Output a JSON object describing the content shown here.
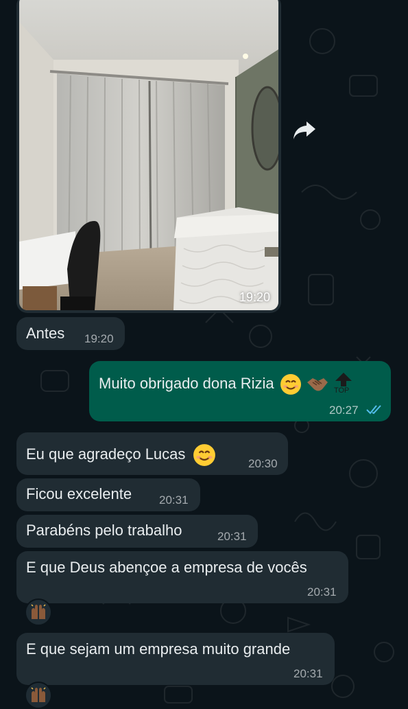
{
  "photo_message": {
    "time": "19:20"
  },
  "messages": [
    {
      "text": "Antes",
      "time": "19:20",
      "direction": "in"
    },
    {
      "text": "Muito obrigado dona Rizia",
      "time": "20:27",
      "direction": "out",
      "status": "read",
      "emojis": [
        "smiling-face-icon",
        "handshake-icon",
        "top-arrow-icon"
      ]
    },
    {
      "text": "Eu que agradeço Lucas",
      "time": "20:30",
      "direction": "in",
      "emojis": [
        "smiling-face-icon"
      ]
    },
    {
      "text": "Ficou excelente",
      "time": "20:31",
      "direction": "in"
    },
    {
      "text": "Parabéns pelo trabalho",
      "time": "20:31",
      "direction": "in"
    },
    {
      "text": "E que Deus abençoe a empresa de vocês",
      "time": "20:31",
      "direction": "in",
      "reaction": "raised-hands-icon"
    },
    {
      "text": "E que sejam um empresa muito grande",
      "time": "20:31",
      "direction": "in",
      "reaction": "raised-hands-icon"
    }
  ],
  "top_label": "TOP",
  "colors": {
    "background": "#0b141a",
    "incoming_bubble": "#202c33",
    "outgoing_bubble": "#005c4b",
    "read_ticks": "#53bdeb"
  }
}
